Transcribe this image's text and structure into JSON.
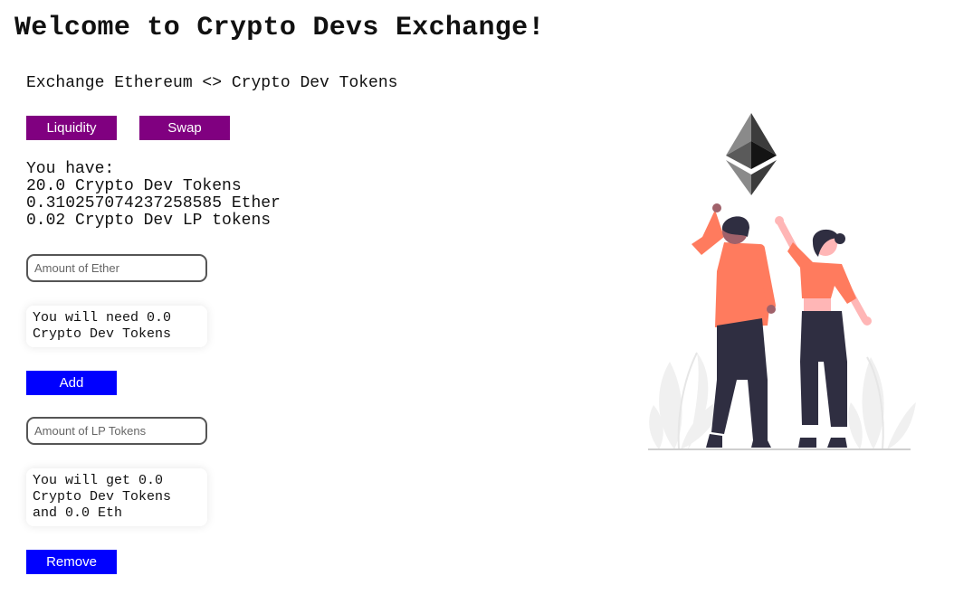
{
  "header": {
    "title": "Welcome to Crypto Devs Exchange!"
  },
  "subtitle": "Exchange Ethereum <> Crypto Dev Tokens",
  "tabs": {
    "liquidity": "Liquidity",
    "swap": "Swap"
  },
  "balances": {
    "heading": "You have:",
    "tokens": "20.0 Crypto Dev Tokens",
    "ether": "0.310257074237258585 Ether",
    "lp": "0.02 Crypto Dev LP tokens"
  },
  "add_liquidity": {
    "ether_placeholder": "Amount of Ether",
    "need_line1": "You will need 0.0",
    "need_line2": "Crypto Dev Tokens",
    "add_label": "Add"
  },
  "remove_liquidity": {
    "lp_placeholder": "Amount of LP Tokens",
    "get_line1": "You will get 0.0",
    "get_line2": "Crypto Dev Tokens",
    "get_line3": "and 0.0 Eth",
    "remove_label": "Remove"
  },
  "colors": {
    "tab_bg": "#800080",
    "action_bg": "#0000ff",
    "shirt": "#ff7b5e",
    "pants": "#2f2e41",
    "skin_dark": "#a0616a",
    "skin_light": "#ffb6b6"
  },
  "illustration": {
    "icon": "ethereum-logo-icon",
    "scene": "two people celebrating"
  }
}
